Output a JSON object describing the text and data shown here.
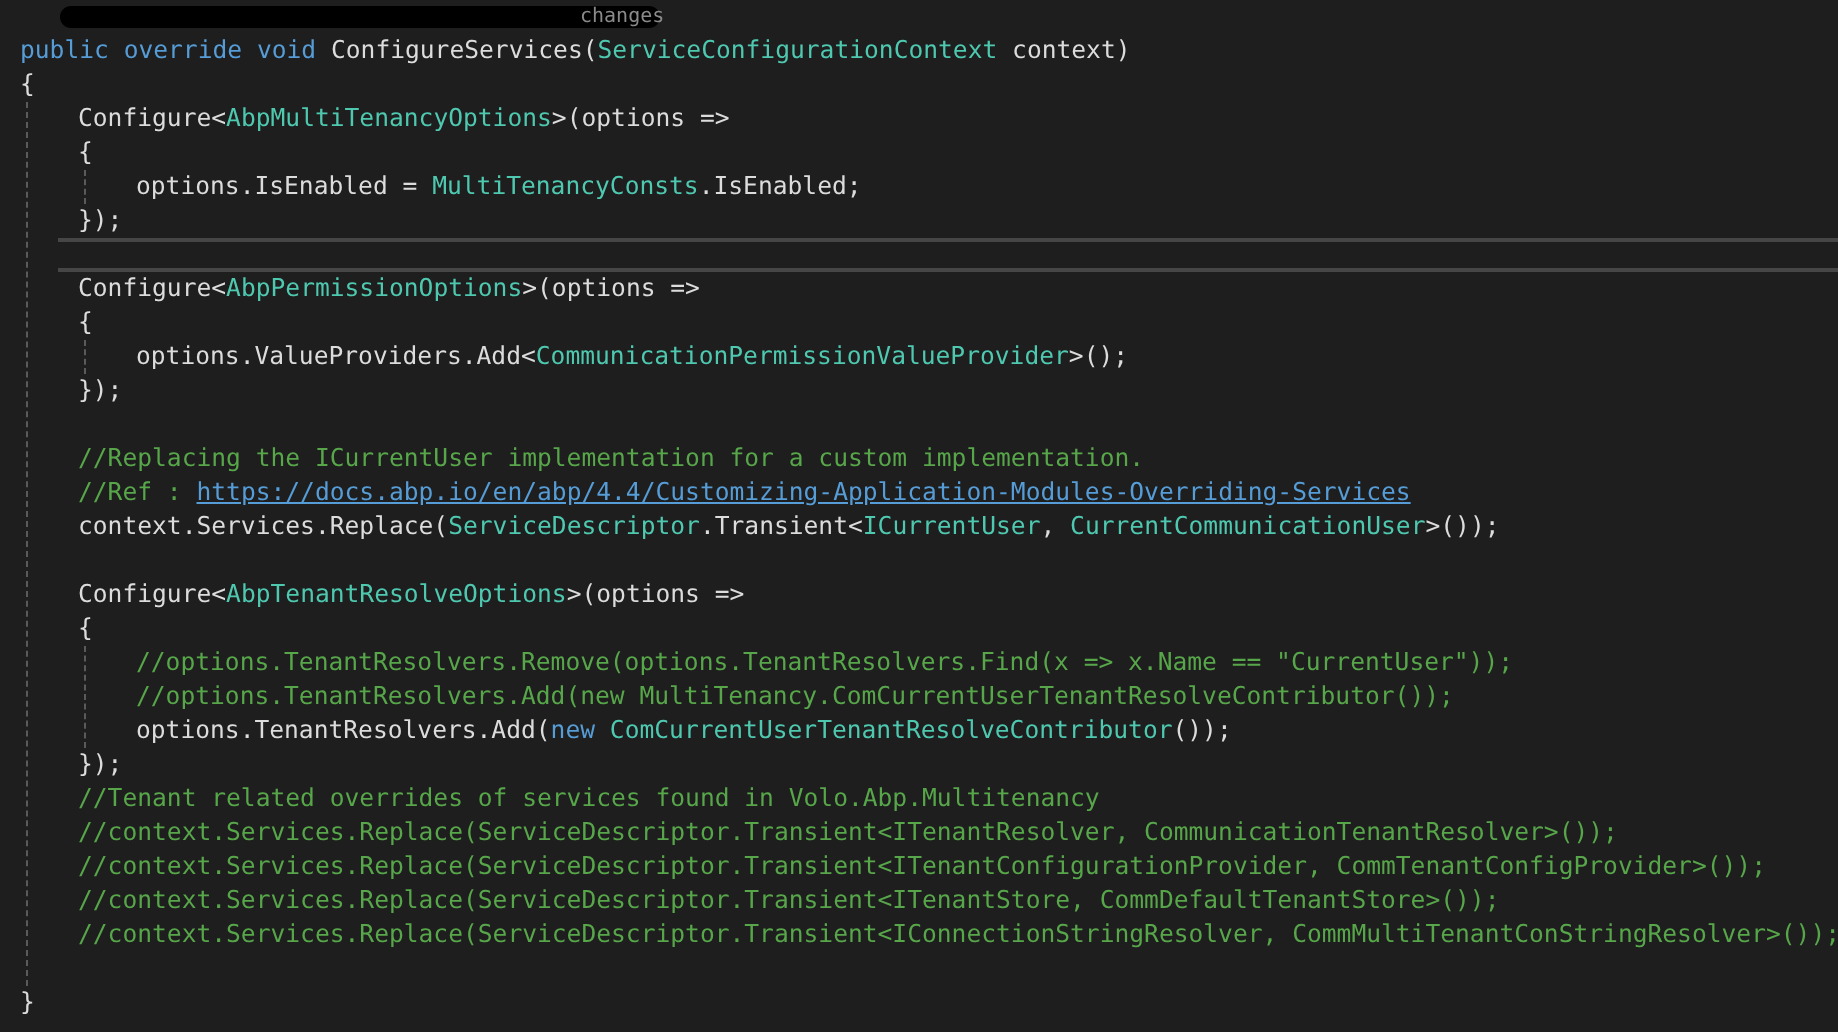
{
  "editor": {
    "lines": [
      {
        "kind": "redacted",
        "tokens": [
          {
            "kind": "faded",
            "text": "changes"
          }
        ]
      },
      {
        "kind": "code",
        "tokens": [
          {
            "kind": "kw",
            "text": "public override void "
          },
          {
            "kind": "plain",
            "text": "ConfigureServices("
          },
          {
            "kind": "type",
            "text": "ServiceConfigurationContext"
          },
          {
            "kind": "plain",
            "text": " context)"
          }
        ]
      },
      {
        "kind": "code",
        "tokens": [
          {
            "kind": "plain",
            "text": "{"
          }
        ],
        "children": [
          {
            "kind": "code",
            "tokens": [
              {
                "kind": "plain",
                "text": "Configure<"
              },
              {
                "kind": "type",
                "text": "AbpMultiTenancyOptions"
              },
              {
                "kind": "plain",
                "text": ">(options =>"
              }
            ]
          },
          {
            "kind": "code",
            "tokens": [
              {
                "kind": "plain",
                "text": "{"
              }
            ],
            "children": [
              {
                "kind": "code",
                "tokens": [
                  {
                    "kind": "plain",
                    "text": "options.IsEnabled = "
                  },
                  {
                    "kind": "type",
                    "text": "MultiTenancyConsts"
                  },
                  {
                    "kind": "plain",
                    "text": ".IsEnabled;"
                  }
                ]
              }
            ]
          },
          {
            "kind": "code",
            "tokens": [
              {
                "kind": "plain",
                "text": "});"
              }
            ]
          },
          {
            "kind": "current"
          },
          {
            "kind": "code",
            "tokens": [
              {
                "kind": "plain",
                "text": "Configure<"
              },
              {
                "kind": "type",
                "text": "AbpPermissionOptions"
              },
              {
                "kind": "plain",
                "text": ">(options =>"
              }
            ]
          },
          {
            "kind": "code",
            "tokens": [
              {
                "kind": "plain",
                "text": "{"
              }
            ],
            "children": [
              {
                "kind": "code",
                "tokens": [
                  {
                    "kind": "plain",
                    "text": "options.ValueProviders.Add<"
                  },
                  {
                    "kind": "type",
                    "text": "CommunicationPermissionValueProvider"
                  },
                  {
                    "kind": "plain",
                    "text": ">();"
                  }
                ]
              }
            ]
          },
          {
            "kind": "code",
            "tokens": [
              {
                "kind": "plain",
                "text": "});"
              }
            ]
          },
          {
            "kind": "blank"
          },
          {
            "kind": "code",
            "tokens": [
              {
                "kind": "comment",
                "text": "//Replacing the ICurrentUser implementation for a custom implementation."
              }
            ]
          },
          {
            "kind": "code",
            "tokens": [
              {
                "kind": "comment",
                "text": "//Ref : "
              },
              {
                "kind": "link",
                "text": "https://docs.abp.io/en/abp/4.4/Customizing-Application-Modules-Overriding-Services"
              }
            ]
          },
          {
            "kind": "code",
            "tokens": [
              {
                "kind": "plain",
                "text": "context.Services.Replace("
              },
              {
                "kind": "type",
                "text": "ServiceDescriptor"
              },
              {
                "kind": "plain",
                "text": ".Transient<"
              },
              {
                "kind": "type",
                "text": "ICurrentUser"
              },
              {
                "kind": "plain",
                "text": ", "
              },
              {
                "kind": "type",
                "text": "CurrentCommunicationUser"
              },
              {
                "kind": "plain",
                "text": ">());"
              }
            ]
          },
          {
            "kind": "blank"
          },
          {
            "kind": "code",
            "tokens": [
              {
                "kind": "plain",
                "text": "Configure<"
              },
              {
                "kind": "type",
                "text": "AbpTenantResolveOptions"
              },
              {
                "kind": "plain",
                "text": ">(options =>"
              }
            ]
          },
          {
            "kind": "code",
            "tokens": [
              {
                "kind": "plain",
                "text": "{"
              }
            ],
            "children": [
              {
                "kind": "code",
                "tokens": [
                  {
                    "kind": "comment",
                    "text": "//options.TenantResolvers.Remove(options.TenantResolvers.Find(x => x.Name == \"CurrentUser\"));"
                  }
                ]
              },
              {
                "kind": "code",
                "tokens": [
                  {
                    "kind": "comment",
                    "text": "//options.TenantResolvers.Add(new MultiTenancy.ComCurrentUserTenantResolveContributor());"
                  }
                ]
              },
              {
                "kind": "code",
                "tokens": [
                  {
                    "kind": "plain",
                    "text": "options.TenantResolvers.Add("
                  },
                  {
                    "kind": "kw",
                    "text": "new "
                  },
                  {
                    "kind": "type",
                    "text": "ComCurrentUserTenantResolveContributor"
                  },
                  {
                    "kind": "plain",
                    "text": "());"
                  }
                ]
              }
            ]
          },
          {
            "kind": "code",
            "tokens": [
              {
                "kind": "plain",
                "text": "});"
              }
            ]
          },
          {
            "kind": "code",
            "tokens": [
              {
                "kind": "comment",
                "text": "//Tenant related overrides of services found in Volo.Abp.Multitenancy"
              }
            ]
          },
          {
            "kind": "code",
            "tokens": [
              {
                "kind": "comment",
                "text": "//context.Services.Replace(ServiceDescriptor.Transient<ITenantResolver, CommunicationTenantResolver>());"
              }
            ]
          },
          {
            "kind": "code",
            "tokens": [
              {
                "kind": "comment",
                "text": "//context.Services.Replace(ServiceDescriptor.Transient<ITenantConfigurationProvider, CommTenantConfigProvider>());"
              }
            ]
          },
          {
            "kind": "code",
            "tokens": [
              {
                "kind": "comment",
                "text": "//context.Services.Replace(ServiceDescriptor.Transient<ITenantStore, CommDefaultTenantStore>());"
              }
            ]
          },
          {
            "kind": "code",
            "tokens": [
              {
                "kind": "comment",
                "text": "//context.Services.Replace(ServiceDescriptor.Transient<IConnectionStringResolver, CommMultiTenantConStringResolver>());"
              }
            ]
          },
          {
            "kind": "blank"
          }
        ]
      },
      {
        "kind": "code",
        "tokens": [
          {
            "kind": "plain",
            "text": "}"
          }
        ]
      }
    ]
  }
}
